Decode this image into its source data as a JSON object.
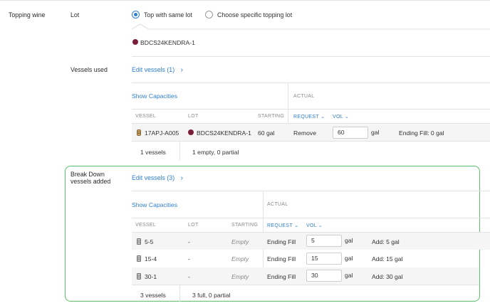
{
  "section_label": "Topping wine",
  "lot": {
    "label": "Lot",
    "option_same": "Top with same lot",
    "option_specific": "Choose specific topping lot",
    "selected_lot": "BDCS24KENDRA-1",
    "lot_color": "#7a1f3a"
  },
  "vessels_used": {
    "label": "Vessels used",
    "edit_link": "Edit vessels (1)",
    "chevron": "›",
    "show_capacities": "Show Capacities",
    "actual_header": "ACTUAL",
    "headers": {
      "vessel": "VESSEL",
      "lot": "LOT",
      "starting": "STARTING",
      "request": "REQUEST",
      "vol": "VOL"
    },
    "row": {
      "vessel": "17APJ-A005",
      "lot": "BDCS24KENDRA-1",
      "starting": "60 gal",
      "request": "Remove",
      "vol_value": "60",
      "unit": "gal",
      "result": "Ending Fill: 0 gal"
    },
    "footer_count": "1 vessels",
    "footer_summary": "1 empty, 0 partial"
  },
  "break_down": {
    "label_line1": "Break Down",
    "label_line2": "vessels added",
    "edit_link": "Edit vessels (3)",
    "chevron": "›",
    "show_capacities": "Show Capacities",
    "actual_header": "ACTUAL",
    "headers": {
      "vessel": "VESSEL",
      "lot": "LOT",
      "starting": "STARTING",
      "request": "REQUEST",
      "vol": "VOL"
    },
    "rows": [
      {
        "vessel": "5-5",
        "lot": "-",
        "starting": "Empty",
        "request": "Ending Fill",
        "vol_value": "5",
        "unit": "gal",
        "result": "Add: 5 gal"
      },
      {
        "vessel": "15-4",
        "lot": "-",
        "starting": "Empty",
        "request": "Ending Fill",
        "vol_value": "15",
        "unit": "gal",
        "result": "Add: 15 gal"
      },
      {
        "vessel": "30-1",
        "lot": "-",
        "starting": "Empty",
        "request": "Ending Fill",
        "vol_value": "30",
        "unit": "gal",
        "result": "Add: 30 gal"
      }
    ],
    "footer_count": "3 vessels",
    "footer_summary": "3 full, 0 partial"
  },
  "colors": {
    "accent": "#2f7fd0",
    "highlight_border": "#5cbf6a",
    "lot_dot": "#7a1f3a"
  }
}
